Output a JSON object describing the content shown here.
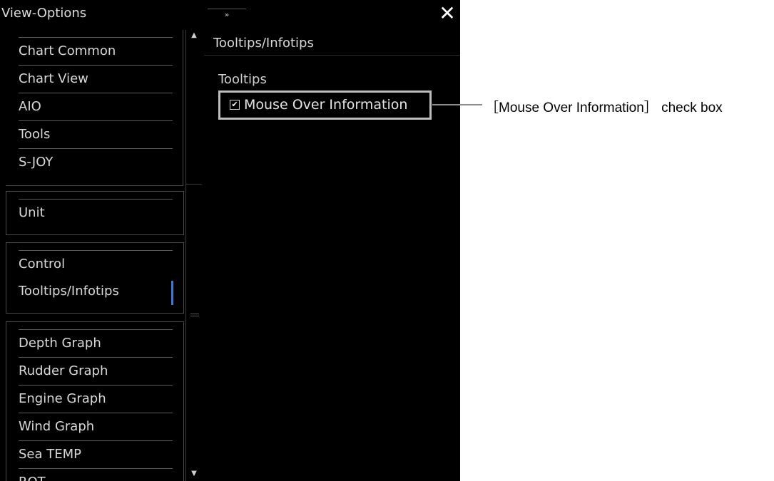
{
  "window": {
    "title": "View-Options",
    "expand_icon": "»",
    "close_icon": "✕"
  },
  "sidebar": {
    "groups": [
      {
        "items": [
          "Chart Common",
          "Chart View",
          "AIO",
          "Tools",
          "S-JOY"
        ]
      },
      {
        "items": [
          "Unit"
        ]
      },
      {
        "items": [
          "Control",
          "Tooltips/Infotips"
        ]
      },
      {
        "items": [
          "Depth Graph",
          "Rudder Graph",
          "Engine Graph",
          "Wind Graph",
          "Sea TEMP",
          "ROT"
        ]
      }
    ],
    "selected": "Tooltips/Infotips",
    "scroll_up": "▲",
    "scroll_down": "▼"
  },
  "panel": {
    "header": "Tooltips/Infotips",
    "section_label": "Tooltips",
    "checkbox": {
      "label": "Mouse Over Information",
      "checked": true,
      "check_glyph": "✔"
    }
  },
  "annotation": {
    "text": "［Mouse Over Information］ check box"
  },
  "colors": {
    "accent": "#3a7bd5",
    "background": "#000000"
  }
}
